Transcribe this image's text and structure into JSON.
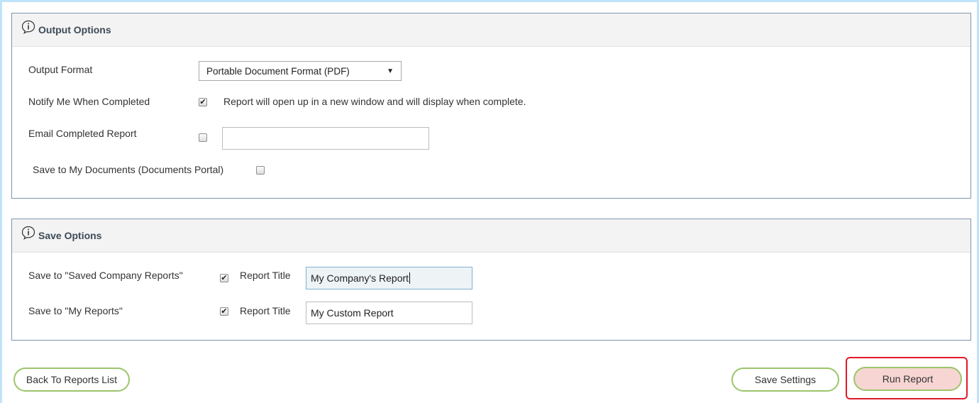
{
  "output_options": {
    "title": "Output Options",
    "output_format": {
      "label": "Output Format",
      "selected": "Portable Document Format (PDF)"
    },
    "notify": {
      "label": "Notify Me When Completed",
      "checked": true,
      "description": "Report will open up in a new window and will display when complete."
    },
    "email": {
      "label": "Email Completed Report",
      "checked": false,
      "value": ""
    },
    "save_docs": {
      "label": "Save to My Documents (Documents Portal)",
      "checked": false
    }
  },
  "save_options": {
    "title": "Save Options",
    "company": {
      "label": "Save to \"Saved Company Reports\"",
      "checked": true,
      "title_label": "Report Title",
      "title_value": "My Company's Report"
    },
    "my_reports": {
      "label": "Save to \"My Reports\"",
      "checked": true,
      "title_label": "Report Title",
      "title_value": "My Custom Report"
    }
  },
  "footer": {
    "back_label": "Back To Reports List",
    "save_settings_label": "Save Settings",
    "run_label": "Run Report"
  },
  "colors": {
    "panel_border": "#7d96ad",
    "button_border": "#9bc56a",
    "highlight": "#e0182a",
    "run_fill": "#f7d5d3"
  },
  "icons": {
    "info": "info-speech-icon",
    "check": "checkmark-icon",
    "dropdown": "dropdown-arrow-icon"
  }
}
